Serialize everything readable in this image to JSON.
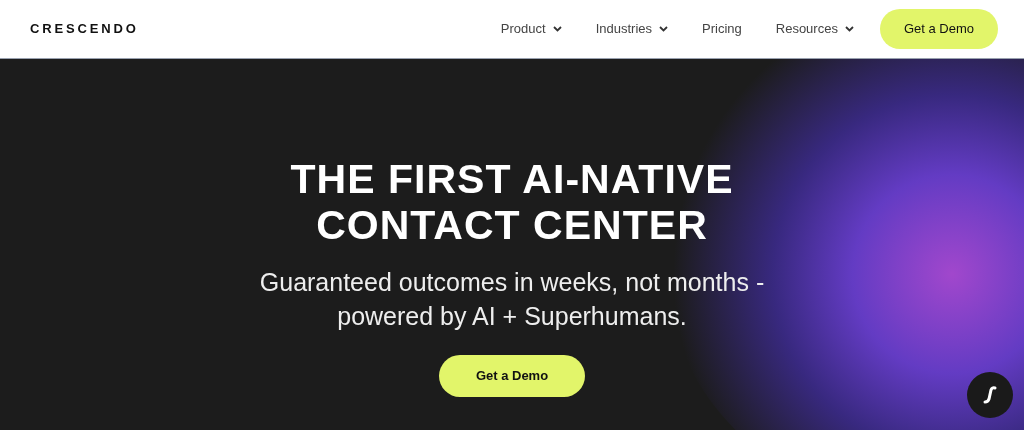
{
  "header": {
    "logo": "CRESCENDO",
    "nav": [
      {
        "label": "Product",
        "has_menu": true
      },
      {
        "label": "Industries",
        "has_menu": true
      },
      {
        "label": "Pricing",
        "has_menu": false
      },
      {
        "label": "Resources",
        "has_menu": true
      }
    ],
    "cta": "Get a Demo"
  },
  "hero": {
    "headline": [
      "THE FIRST AI-NATIVE",
      "CONTACT CENTER"
    ],
    "subtitle": [
      "Guaranteed outcomes in weeks, not months -",
      "powered by AI + Superhumans."
    ],
    "cta": "Get a Demo"
  }
}
